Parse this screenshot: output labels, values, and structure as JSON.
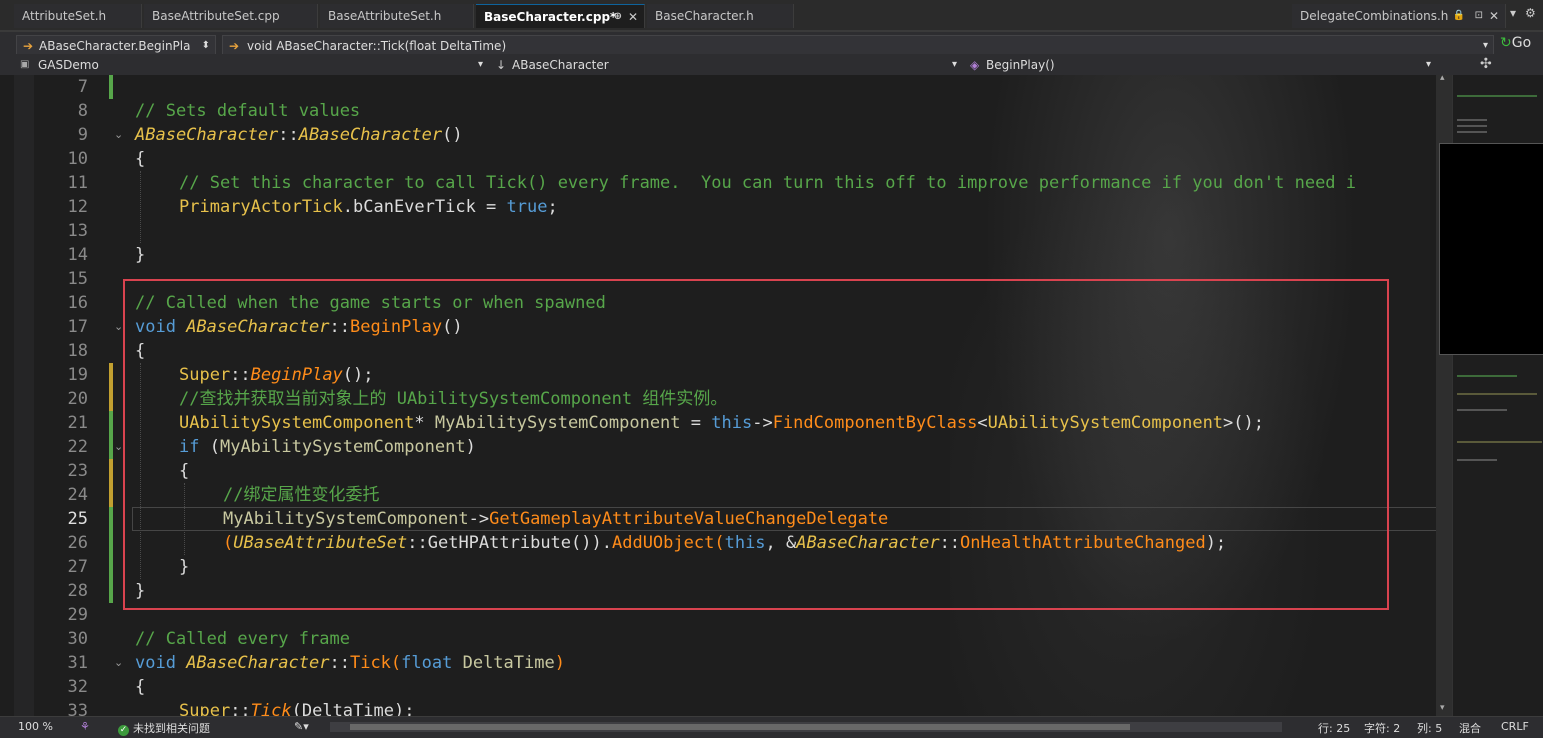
{
  "tabs": [
    {
      "label": "AttributeSet.h",
      "active": false
    },
    {
      "label": "BaseAttributeSet.cpp",
      "active": false
    },
    {
      "label": "BaseAttributeSet.h",
      "active": false
    },
    {
      "label": "BaseCharacter.cpp*",
      "active": true
    },
    {
      "label": "BaseCharacter.h",
      "active": false
    }
  ],
  "right_tab": {
    "label": "DelegateCombinations.h"
  },
  "nav1": {
    "scope": "ABaseCharacter.BeginPla",
    "function": "void ABaseCharacter::Tick(float DeltaTime)",
    "go": "Go"
  },
  "nav2": {
    "project": "GASDemo",
    "class": "ABaseCharacter",
    "member": "BeginPlay()"
  },
  "line_numbers": [
    "7",
    "8",
    "9",
    "10",
    "11",
    "12",
    "13",
    "14",
    "15",
    "16",
    "17",
    "18",
    "19",
    "20",
    "21",
    "22",
    "23",
    "24",
    "25",
    "26",
    "27",
    "28",
    "29",
    "30",
    "31",
    "32",
    "33"
  ],
  "current_line": "25",
  "code": {
    "l8_comment": "// Sets default values",
    "l9_class": "ABaseCharacter",
    "l9_sep": "::",
    "l9_ctor": "ABaseCharacter",
    "l9_paren": "()",
    "l10": "{",
    "l11_comment": "// Set this character to call Tick() every frame.  You can turn this off to improve performance if you don't need i",
    "l12_type": "PrimaryActorTick",
    "l12_member": ".bCanEverTick = ",
    "l12_true": "true",
    "l12_end": ";",
    "l14": "}",
    "l16_comment": "// Called when the game starts or when spawned",
    "l17_void": "void ",
    "l17_class": "ABaseCharacter",
    "l17_sep": "::",
    "l17_fn": "BeginPlay",
    "l17_paren": "()",
    "l18": "{",
    "l19_super": "Super",
    "l19_sep": "::",
    "l19_fn": "BeginPlay",
    "l19_end": "();",
    "l20_comment": "//查找并获取当前对象上的 UAbilitySystemComponent 组件实例。",
    "l21_type": "UAbilitySystemComponent",
    "l21_star": "* ",
    "l21_var": "MyAbilitySystemComponent",
    "l21_eq": " = ",
    "l21_this": "this",
    "l21_arrow": "->",
    "l21_fn": "FindComponentByClass",
    "l21_lt": "<",
    "l21_tmpl": "UAbilitySystemComponent",
    "l21_end": ">();",
    "l22_if": "if",
    "l22_open": " (",
    "l22_var": "MyAbilitySystemComponent",
    "l22_close": ")",
    "l23": "{",
    "l24_comment": "//绑定属性变化委托",
    "l25_var": "MyAbilitySystemComponent",
    "l25_arrow": "->",
    "l25_fn": "GetGameplayAttributeValueChangeDelegate",
    "l26_open": "(",
    "l26_class": "UBaseAttributeSet",
    "l26_sep": "::",
    "l26_fn": "GetHPAttribute",
    "l26_mid": "()).",
    "l26_add": "AddUObject",
    "l26_p": "(",
    "l26_this": "this",
    "l26_amp": ", &",
    "l26_cls2": "ABaseCharacter",
    "l26_sep2": "::",
    "l26_cb": "OnHealthAttributeChanged",
    "l26_end": ");",
    "l27": "}",
    "l28": "}",
    "l30_comment": "// Called every frame",
    "l31_void": "void ",
    "l31_class": "ABaseCharacter",
    "l31_sep": "::",
    "l31_fn": "Tick",
    "l31_p1": "(",
    "l31_float": "float",
    "l31_param": " DeltaTime",
    "l31_p2": ")",
    "l32": "{",
    "l33_super": "Super",
    "l33_sep": "::",
    "l33_fn": "Tick",
    "l33_end": "(DeltaTime);"
  },
  "status": {
    "zoom": "100 %",
    "issues": "未找到相关问题",
    "line": "行: 25",
    "char": "字符: 2",
    "col": "列: 5",
    "mode": "混合",
    "eol": "CRLF"
  },
  "colors": {
    "comment": "#57a64a",
    "keyword": "#569cd6",
    "class": "#e7c14b",
    "function": "#ff8c1a",
    "highlight_box": "#d9434f"
  }
}
